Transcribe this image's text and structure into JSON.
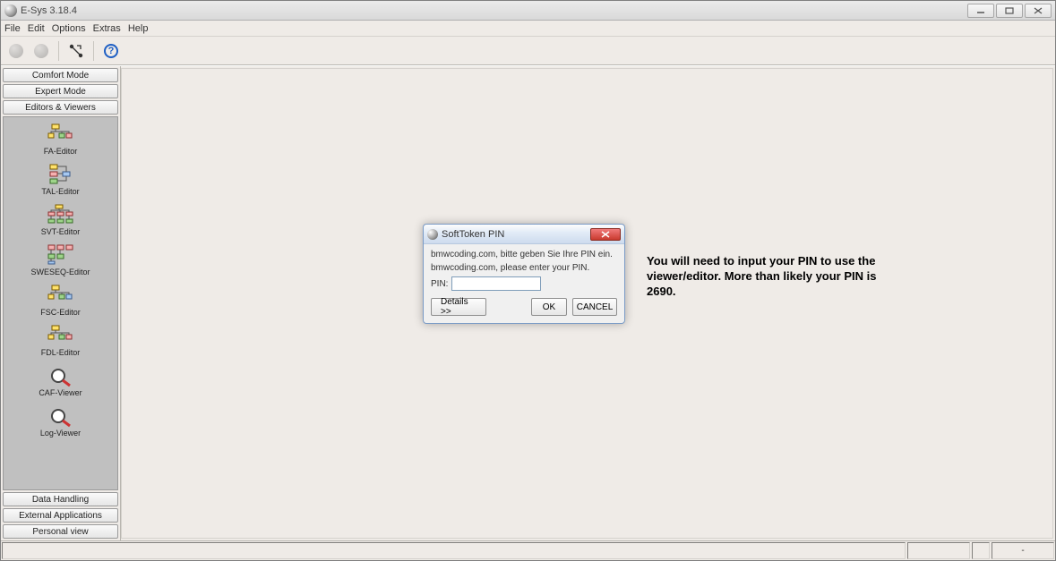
{
  "window": {
    "title": "E-Sys 3.18.4"
  },
  "menu": {
    "file": "File",
    "edit": "Edit",
    "options": "Options",
    "extras": "Extras",
    "help": "Help"
  },
  "sidebar": {
    "comfort": "Comfort Mode",
    "expert": "Expert Mode",
    "editors": "Editors & Viewers",
    "data_handling": "Data Handling",
    "external": "External Applications",
    "personal": "Personal view",
    "items": [
      {
        "label": "FA-Editor"
      },
      {
        "label": "TAL-Editor"
      },
      {
        "label": "SVT-Editor"
      },
      {
        "label": "SWESEQ-Editor"
      },
      {
        "label": "FSC-Editor"
      },
      {
        "label": "FDL-Editor"
      },
      {
        "label": "CAF-Viewer"
      },
      {
        "label": "Log-Viewer"
      }
    ]
  },
  "dialog": {
    "title": "SoftToken PIN",
    "line1": "bmwcoding.com, bitte geben Sie Ihre PIN ein.",
    "line2": "bmwcoding.com, please enter your PIN.",
    "pin_label": "PIN:",
    "pin_value": "",
    "details": "Details >>",
    "ok": "OK",
    "cancel": "CANCEL"
  },
  "annotation": "You will need to input your PIN to use the viewer/editor.  More than likely your PIN is 2690.",
  "status": {
    "left": "",
    "right": "-"
  }
}
